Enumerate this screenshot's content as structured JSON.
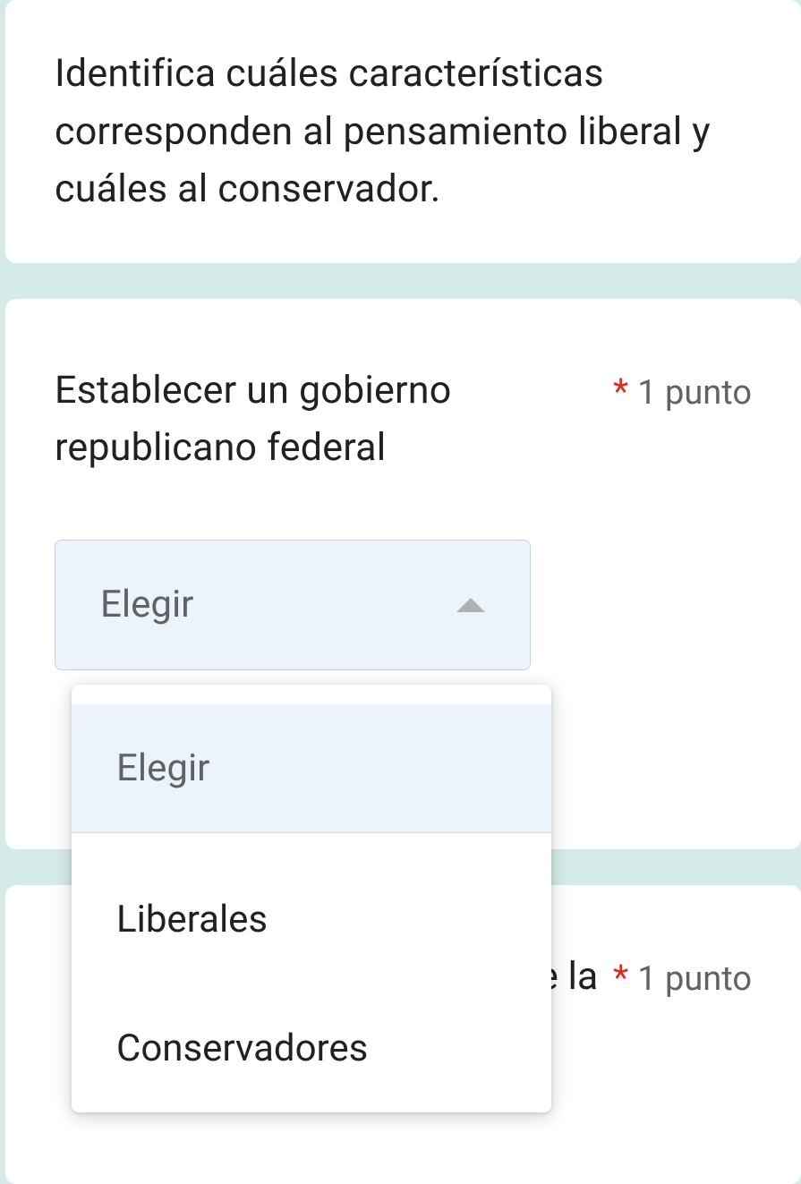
{
  "instruction": "Identifica cuáles características corresponden al pensamiento liberal y cuáles al conservador.",
  "question1": {
    "text": "Establecer un gobierno republicano federal",
    "required_mark": "*",
    "points": "1 punto",
    "dropdown": {
      "selected": "Elegir",
      "options": {
        "placeholder": "Elegir",
        "opt1": "Liberales",
        "opt2": "Conservadores"
      }
    }
  },
  "question2": {
    "partial_text": "e la",
    "required_mark": "*",
    "points": "1 punto"
  }
}
